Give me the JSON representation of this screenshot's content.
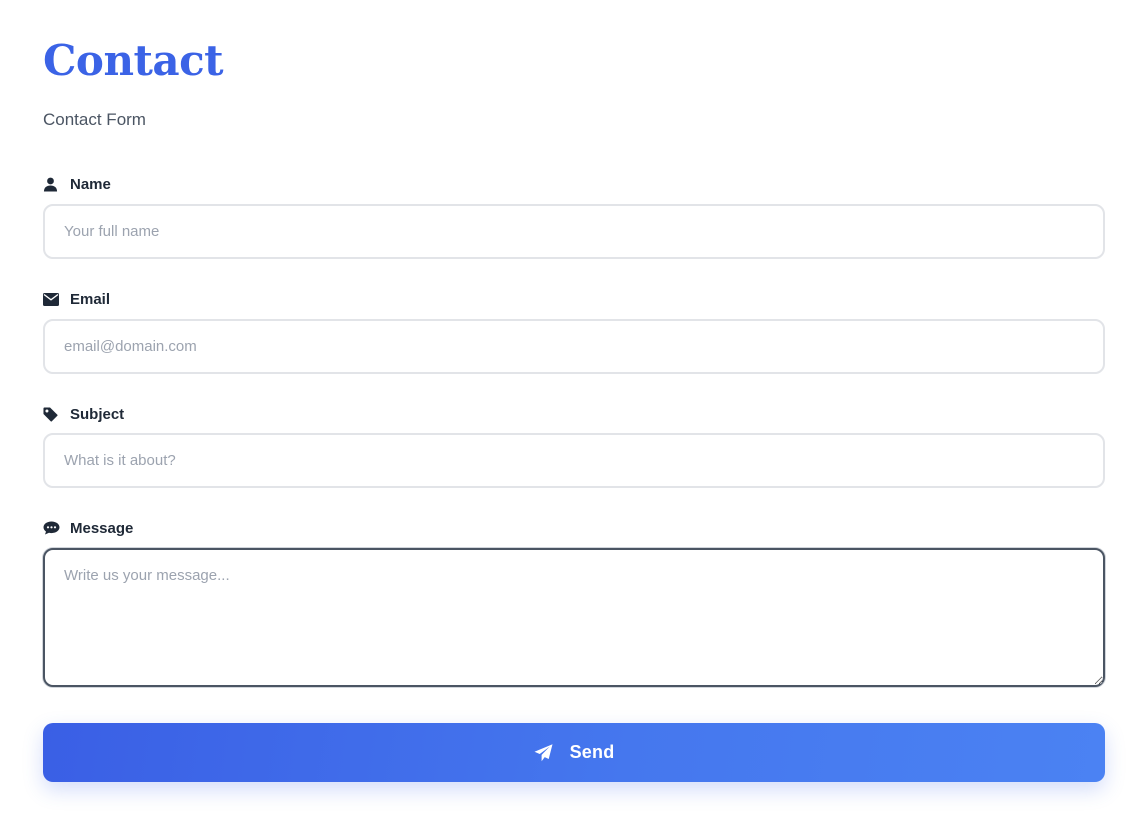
{
  "header": {
    "title": "Contact",
    "subtitle": "Contact Form"
  },
  "form": {
    "name": {
      "label": "Name",
      "placeholder": "Your full name",
      "icon": "user-icon"
    },
    "email": {
      "label": "Email",
      "placeholder": "email@domain.com",
      "icon": "envelope-icon"
    },
    "subject": {
      "label": "Subject",
      "placeholder": "What is it about?",
      "icon": "tag-icon"
    },
    "message": {
      "label": "Message",
      "placeholder": "Write us your message...",
      "icon": "comments-icon"
    },
    "submit": {
      "label": "Send",
      "icon": "paper-plane-icon"
    }
  },
  "colors": {
    "accent": "#3b63e6",
    "button_gradient_start": "#3a5fe5",
    "button_gradient_end": "#4b82f3",
    "label_text": "#1f2937",
    "placeholder_text": "#9ca3af",
    "input_border": "#e2e4e8"
  }
}
